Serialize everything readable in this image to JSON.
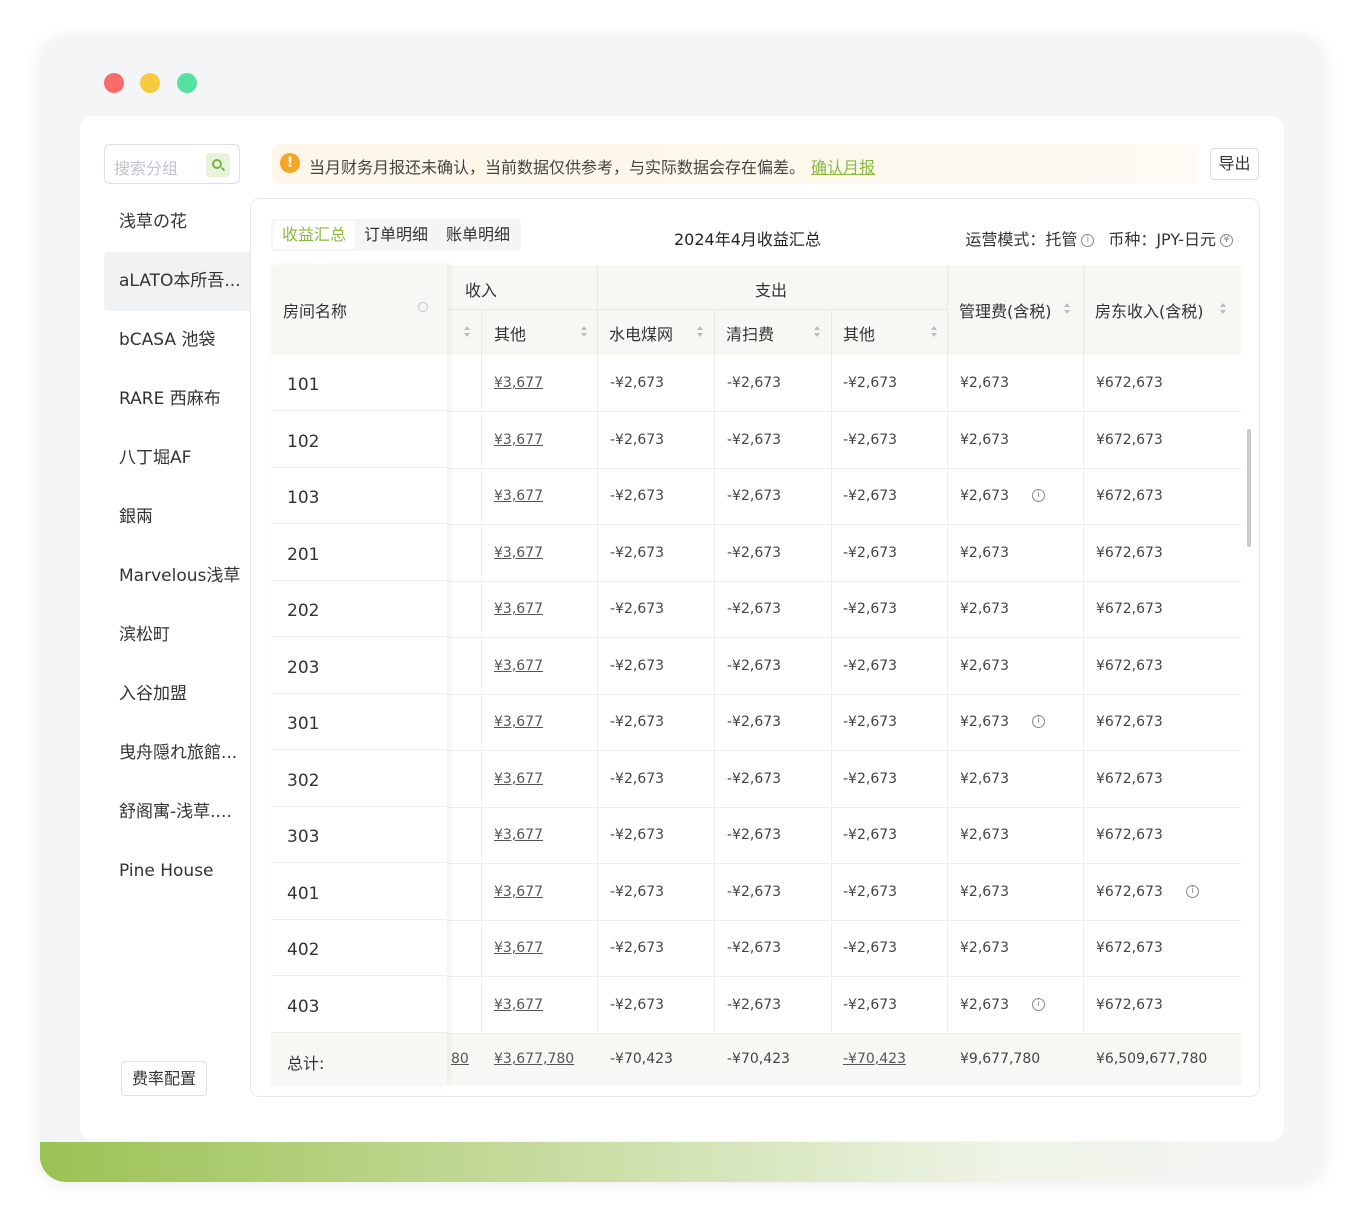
{
  "sidebar": {
    "search_placeholder": "搜索分组",
    "groups": [
      "浅草の花",
      "aLATO本所吾...",
      "bCASA 池袋",
      "RARE 西麻布",
      "八丁堀AF",
      "銀兩",
      "Marvelous浅草",
      "滨松町",
      "入谷加盟",
      "曳舟隠れ旅館...",
      "舒阁寓-浅草....",
      "Pine House"
    ],
    "active_index": 1,
    "rate_config_label": "费率配置"
  },
  "alert": {
    "text": "当月财务月报还未确认，当前数据仅供参考，与实际数据会存在偏差。",
    "link": "确认月报",
    "icon": "warning-icon"
  },
  "export_label": "导出",
  "panel": {
    "tabs": [
      "收益汇总",
      "订单明细",
      "账单明细"
    ],
    "active_tab": 0,
    "title": "2024年4月收益汇总",
    "mode_label": "运营模式：托管",
    "currency_label": "币种：JPY-日元"
  },
  "table": {
    "room_header": "房间名称",
    "income_header": "收入",
    "expense_header": "支出",
    "col_income_other": "其他",
    "col_utilities": "水电煤网",
    "col_cleaning": "清扫费",
    "col_expense_other": "其他",
    "col_mgmt": "管理费(含税)",
    "col_owner": "房东收入(含税)",
    "rows": [
      {
        "room": "101",
        "income_other": "¥3,677",
        "utilities": "-¥2,673",
        "cleaning": "-¥2,673",
        "expense_other": "-¥2,673",
        "mgmt": "¥2,673",
        "owner": "¥672,673",
        "mgmt_info": false,
        "owner_info": false
      },
      {
        "room": "102",
        "income_other": "¥3,677",
        "utilities": "-¥2,673",
        "cleaning": "-¥2,673",
        "expense_other": "-¥2,673",
        "mgmt": "¥2,673",
        "owner": "¥672,673",
        "mgmt_info": false,
        "owner_info": false
      },
      {
        "room": "103",
        "income_other": "¥3,677",
        "utilities": "-¥2,673",
        "cleaning": "-¥2,673",
        "expense_other": "-¥2,673",
        "mgmt": "¥2,673",
        "owner": "¥672,673",
        "mgmt_info": true,
        "owner_info": false
      },
      {
        "room": "201",
        "income_other": "¥3,677",
        "utilities": "-¥2,673",
        "cleaning": "-¥2,673",
        "expense_other": "-¥2,673",
        "mgmt": "¥2,673",
        "owner": "¥672,673",
        "mgmt_info": false,
        "owner_info": false
      },
      {
        "room": "202",
        "income_other": "¥3,677",
        "utilities": "-¥2,673",
        "cleaning": "-¥2,673",
        "expense_other": "-¥2,673",
        "mgmt": "¥2,673",
        "owner": "¥672,673",
        "mgmt_info": false,
        "owner_info": false
      },
      {
        "room": "203",
        "income_other": "¥3,677",
        "utilities": "-¥2,673",
        "cleaning": "-¥2,673",
        "expense_other": "-¥2,673",
        "mgmt": "¥2,673",
        "owner": "¥672,673",
        "mgmt_info": false,
        "owner_info": false
      },
      {
        "room": "301",
        "income_other": "¥3,677",
        "utilities": "-¥2,673",
        "cleaning": "-¥2,673",
        "expense_other": "-¥2,673",
        "mgmt": "¥2,673",
        "owner": "¥672,673",
        "mgmt_info": true,
        "owner_info": false
      },
      {
        "room": "302",
        "income_other": "¥3,677",
        "utilities": "-¥2,673",
        "cleaning": "-¥2,673",
        "expense_other": "-¥2,673",
        "mgmt": "¥2,673",
        "owner": "¥672,673",
        "mgmt_info": false,
        "owner_info": false
      },
      {
        "room": "303",
        "income_other": "¥3,677",
        "utilities": "-¥2,673",
        "cleaning": "-¥2,673",
        "expense_other": "-¥2,673",
        "mgmt": "¥2,673",
        "owner": "¥672,673",
        "mgmt_info": false,
        "owner_info": false
      },
      {
        "room": "401",
        "income_other": "¥3,677",
        "utilities": "-¥2,673",
        "cleaning": "-¥2,673",
        "expense_other": "-¥2,673",
        "mgmt": "¥2,673",
        "owner": "¥672,673",
        "mgmt_info": false,
        "owner_info": true
      },
      {
        "room": "402",
        "income_other": "¥3,677",
        "utilities": "-¥2,673",
        "cleaning": "-¥2,673",
        "expense_other": "-¥2,673",
        "mgmt": "¥2,673",
        "owner": "¥672,673",
        "mgmt_info": false,
        "owner_info": false
      },
      {
        "room": "403",
        "income_other": "¥3,677",
        "utilities": "-¥2,673",
        "cleaning": "-¥2,673",
        "expense_other": "-¥2,673",
        "mgmt": "¥2,673",
        "owner": "¥672,673",
        "mgmt_info": true,
        "owner_info": false
      }
    ],
    "total": {
      "label": "总计:",
      "hidden_partial": "80",
      "income_other": "¥3,677,780",
      "utilities": "-¥70,423",
      "cleaning": "-¥70,423",
      "expense_other": "-¥70,423",
      "mgmt": "¥9,677,780",
      "owner": "¥6,509,677,780"
    }
  },
  "colors": {
    "accent": "#8bb93e",
    "header_bg": "#f7f8f3",
    "warning": "#f5a623"
  }
}
